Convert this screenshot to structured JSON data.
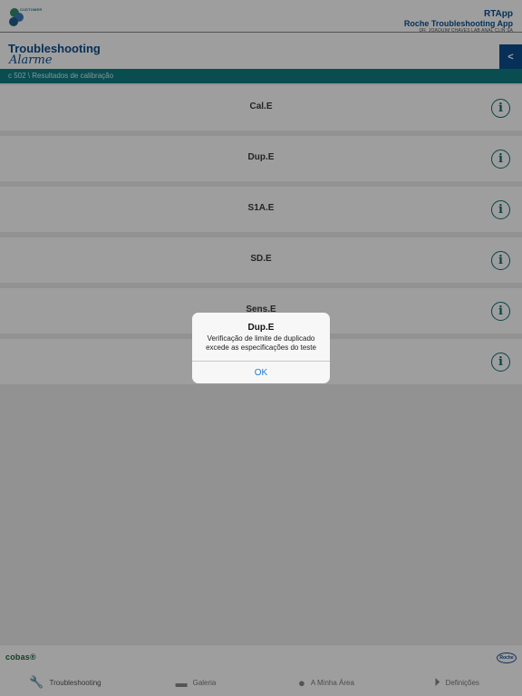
{
  "header": {
    "logo_text": "CUSTOMER",
    "app_short": "RTApp",
    "app_full": "Roche Troubleshooting App",
    "lab": "DR. JOAQUIM CHAVES LAB ANAL CLIN SA"
  },
  "page": {
    "title": "Troubleshooting",
    "subtitle": "Alarme",
    "back_label": "<",
    "breadcrumb": "c 502 \\ Resultados de calibração"
  },
  "list": {
    "items": [
      {
        "label": "Cal.E"
      },
      {
        "label": "Dup.E"
      },
      {
        "label": "S1A.E"
      },
      {
        "label": "SD.E"
      },
      {
        "label": "Sens.E"
      },
      {
        "label": ""
      }
    ]
  },
  "footer": {
    "cobas": "cobas®",
    "roche": "Roche",
    "tabs": [
      {
        "label": "Troubleshooting",
        "icon": "wrench-icon"
      },
      {
        "label": "Galeria",
        "icon": "folder-icon"
      },
      {
        "label": "A Minha Área",
        "icon": "user-icon"
      },
      {
        "label": "Definições",
        "icon": "play-circle-icon"
      }
    ]
  },
  "alert": {
    "title": "Dup.E",
    "message": "Verificação de limite de duplicado excede as especificações do teste",
    "ok_label": "OK"
  },
  "colors": {
    "brand_blue": "#0a4e8f",
    "teal": "#0f7c84",
    "ios_blue": "#1e7ad6"
  }
}
